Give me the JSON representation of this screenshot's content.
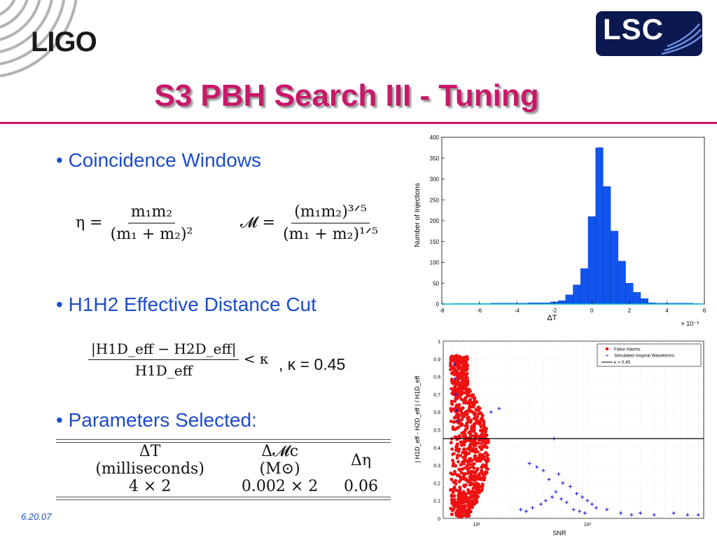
{
  "header": {
    "ligo_logo": "LIGO",
    "lsc_logo": "LSC",
    "title": "S3 PBH Search III - Tuning"
  },
  "bullets": {
    "coincidence": "• Coincidence Windows",
    "distance_cut": "• H1H2 Effective Distance Cut",
    "parameters": "• Parameters Selected:"
  },
  "equations": {
    "eta": {
      "lhs": "η =",
      "num": "m₁m₂",
      "den": "(m₁ + m₂)²"
    },
    "chirp": {
      "lhs": "𝓜 =",
      "num": "(m₁m₂)³ᐟ⁵",
      "den": "(m₁ + m₂)¹ᐟ⁵"
    },
    "cut": {
      "num": "|H1D_eff − H2D_eff|",
      "den": "H1D_eff",
      "rhs": "< κ"
    },
    "kappa_value": ", κ = 0.45"
  },
  "params_table": {
    "headers": [
      "ΔT (milliseconds)",
      "Δ𝓜c (M⊙)",
      "Δη"
    ],
    "row": [
      "4 × 2",
      "0.002 × 2",
      "0.06"
    ]
  },
  "footer": {
    "date": "6.20.07"
  },
  "chart_data": [
    {
      "type": "bar",
      "title": "",
      "xlabel": "ΔT",
      "ylabel": "Number of Injections",
      "x_multiplier": "× 10⁻³",
      "xlim": [
        -8,
        6
      ],
      "ylim": [
        0,
        400
      ],
      "xticks": [
        -8,
        -6,
        -4,
        -2,
        0,
        2,
        4,
        6
      ],
      "yticks": [
        0,
        50,
        100,
        150,
        200,
        250,
        300,
        350,
        400
      ],
      "bin_width": 0.4,
      "bin_centers": [
        -7.2,
        -6.8,
        -6.4,
        -6.0,
        -5.6,
        -5.2,
        -4.8,
        -4.4,
        -4.0,
        -3.6,
        -3.2,
        -2.8,
        -2.4,
        -2.0,
        -1.6,
        -1.2,
        -0.8,
        -0.4,
        0.0,
        0.4,
        0.8,
        1.2,
        1.6,
        2.0,
        2.4,
        2.8,
        3.2,
        3.6,
        4.0,
        4.4,
        4.8,
        5.2,
        5.6
      ],
      "values": [
        1,
        1,
        1,
        1,
        1,
        2,
        2,
        2,
        2,
        2,
        3,
        3,
        3,
        5,
        8,
        22,
        46,
        85,
        210,
        375,
        282,
        175,
        103,
        50,
        28,
        13,
        3,
        2,
        2,
        2,
        2,
        2,
        1
      ],
      "color": "#1155ee"
    },
    {
      "type": "scatter",
      "title": "",
      "xlabel": "SNR",
      "ylabel": "| H1D_eff - H2D_eff | / H1D_eff",
      "x_scale": "log",
      "xlim": [
        5,
        140
      ],
      "ylim": [
        0,
        1
      ],
      "xticks": [
        10,
        100
      ],
      "xtick_labels": [
        "10¹",
        "10²"
      ],
      "yticks": [
        0,
        0.1,
        0.2,
        0.3,
        0.4,
        0.5,
        0.6,
        0.7,
        0.8,
        0.9,
        1
      ],
      "grid": true,
      "legend_position": "top-right",
      "series": [
        {
          "name": "False Alarms",
          "marker": "dot",
          "color": "#ee1111",
          "region": {
            "snr_min": 5.8,
            "snr_max": 13,
            "y_min": 0.01,
            "y_max": 0.92
          }
        },
        {
          "name": "Simulated Inspiral Waveforms",
          "marker": "plus",
          "color": "#1111cc",
          "points": [
            [
              6.3,
              0.87
            ],
            [
              6.4,
              0.79
            ],
            [
              6.5,
              0.7
            ],
            [
              6.6,
              0.61
            ],
            [
              6.7,
              0.55
            ],
            [
              13.5,
              0.6
            ],
            [
              16,
              0.62
            ],
            [
              50,
              0.45
            ],
            [
              30,
              0.31
            ],
            [
              35,
              0.29
            ],
            [
              40,
              0.27
            ],
            [
              45,
              0.22
            ],
            [
              55,
              0.25
            ],
            [
              60,
              0.2
            ],
            [
              70,
              0.18
            ],
            [
              80,
              0.14
            ],
            [
              90,
              0.12
            ],
            [
              100,
              0.1
            ],
            [
              110,
              0.08
            ],
            [
              120,
              0.06
            ],
            [
              150,
              0.05
            ],
            [
              200,
              0.03
            ],
            [
              250,
              0.02
            ],
            [
              300,
              0.03
            ],
            [
              400,
              0.02
            ],
            [
              600,
              0.03
            ],
            [
              800,
              0.02
            ],
            [
              1000,
              0.02
            ],
            [
              25,
              0.05
            ],
            [
              28,
              0.04
            ],
            [
              32,
              0.06
            ],
            [
              38,
              0.08
            ],
            [
              42,
              0.1
            ],
            [
              48,
              0.12
            ],
            [
              52,
              0.15
            ],
            [
              58,
              0.11
            ],
            [
              65,
              0.09
            ],
            [
              75,
              0.05
            ],
            [
              85,
              0.04
            ],
            [
              95,
              0.03
            ]
          ]
        },
        {
          "name": "κ = 0.45",
          "type": "line",
          "color": "#000000",
          "y": 0.45
        }
      ]
    }
  ]
}
